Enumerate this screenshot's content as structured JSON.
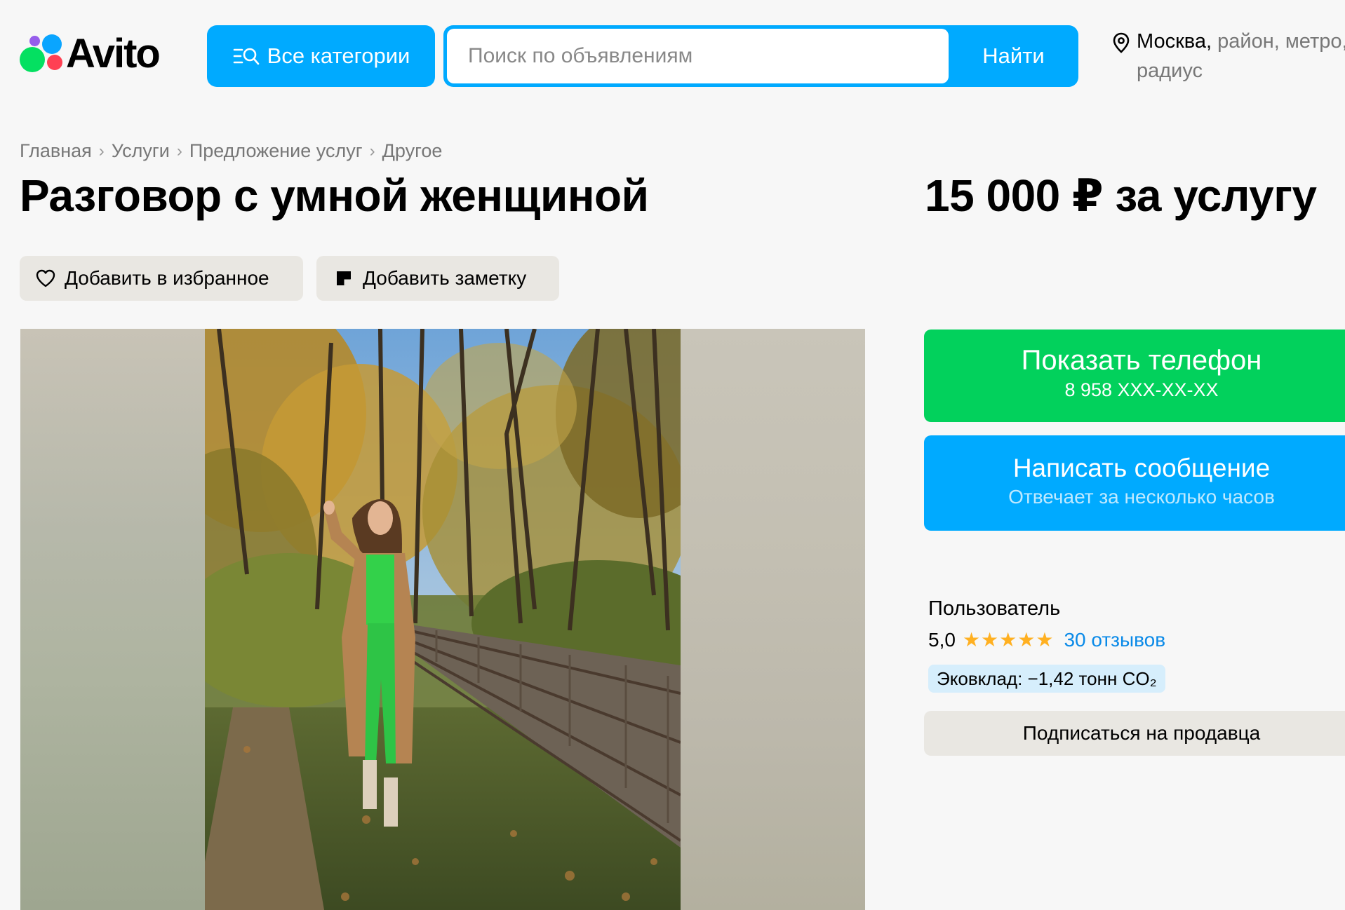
{
  "header": {
    "logo_text": "Avito",
    "categories_label": "Все категории",
    "search_placeholder": "Поиск по объявлениям",
    "search_button": "Найти",
    "location_city": "Москва,",
    "location_rest": " район, метро,",
    "location_line2": "радиус"
  },
  "breadcrumb": [
    "Главная",
    "Услуги",
    "Предложение услуг",
    "Другое"
  ],
  "listing": {
    "title": "Разговор с умной женщиной",
    "price": "15 000 ₽ за услугу",
    "favorite_label": "Добавить в избранное",
    "note_label": "Добавить заметку"
  },
  "contact": {
    "phone_label": "Показать телефон",
    "phone_masked": "8 958 XXX-XX-XX",
    "message_label": "Написать сообщение",
    "message_sub": "Отвечает за несколько часов"
  },
  "seller": {
    "name": "Пользователь",
    "rating": "5,0",
    "stars": "★★★★★",
    "stars_count": 5,
    "reviews": "30 отзывов",
    "eco": "Эковклад: −1,42 тонн CO₂",
    "subscribe_label": "Подписаться на продавца"
  },
  "colors": {
    "accent_blue": "#00aaff",
    "green": "#02d15c",
    "star": "#ffb021",
    "link": "#0a8ae8"
  }
}
